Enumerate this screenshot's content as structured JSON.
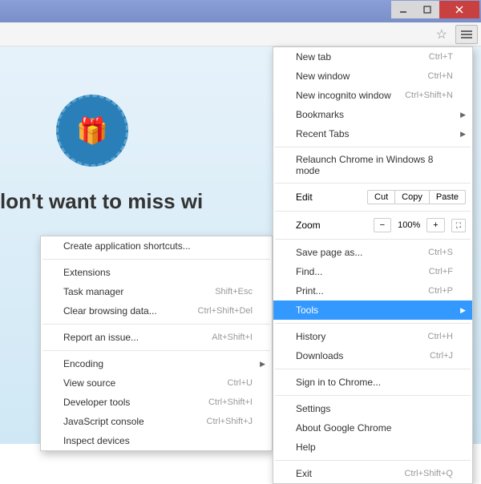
{
  "titlebar": {
    "min": "−",
    "max": "▢",
    "close": "✕"
  },
  "content": {
    "headline": "lon't want to miss wi"
  },
  "menu": {
    "new_tab": {
      "label": "New tab",
      "shortcut": "Ctrl+T"
    },
    "new_window": {
      "label": "New window",
      "shortcut": "Ctrl+N"
    },
    "new_incognito": {
      "label": "New incognito window",
      "shortcut": "Ctrl+Shift+N"
    },
    "bookmarks": {
      "label": "Bookmarks"
    },
    "recent_tabs": {
      "label": "Recent Tabs"
    },
    "relaunch": {
      "label": "Relaunch Chrome in Windows 8 mode"
    },
    "edit": {
      "label": "Edit",
      "cut": "Cut",
      "copy": "Copy",
      "paste": "Paste"
    },
    "zoom": {
      "label": "Zoom",
      "minus": "−",
      "value": "100%",
      "plus": "+"
    },
    "save_as": {
      "label": "Save page as...",
      "shortcut": "Ctrl+S"
    },
    "find": {
      "label": "Find...",
      "shortcut": "Ctrl+F"
    },
    "print": {
      "label": "Print...",
      "shortcut": "Ctrl+P"
    },
    "tools": {
      "label": "Tools"
    },
    "history": {
      "label": "History",
      "shortcut": "Ctrl+H"
    },
    "downloads": {
      "label": "Downloads",
      "shortcut": "Ctrl+J"
    },
    "signin": {
      "label": "Sign in to Chrome..."
    },
    "settings": {
      "label": "Settings"
    },
    "about": {
      "label": "About Google Chrome"
    },
    "help": {
      "label": "Help"
    },
    "exit": {
      "label": "Exit",
      "shortcut": "Ctrl+Shift+Q"
    }
  },
  "submenu": {
    "create_shortcuts": {
      "label": "Create application shortcuts..."
    },
    "extensions": {
      "label": "Extensions"
    },
    "task_manager": {
      "label": "Task manager",
      "shortcut": "Shift+Esc"
    },
    "clear_data": {
      "label": "Clear browsing data...",
      "shortcut": "Ctrl+Shift+Del"
    },
    "report_issue": {
      "label": "Report an issue...",
      "shortcut": "Alt+Shift+I"
    },
    "encoding": {
      "label": "Encoding"
    },
    "view_source": {
      "label": "View source",
      "shortcut": "Ctrl+U"
    },
    "dev_tools": {
      "label": "Developer tools",
      "shortcut": "Ctrl+Shift+I"
    },
    "js_console": {
      "label": "JavaScript console",
      "shortcut": "Ctrl+Shift+J"
    },
    "inspect_devices": {
      "label": "Inspect devices"
    }
  }
}
